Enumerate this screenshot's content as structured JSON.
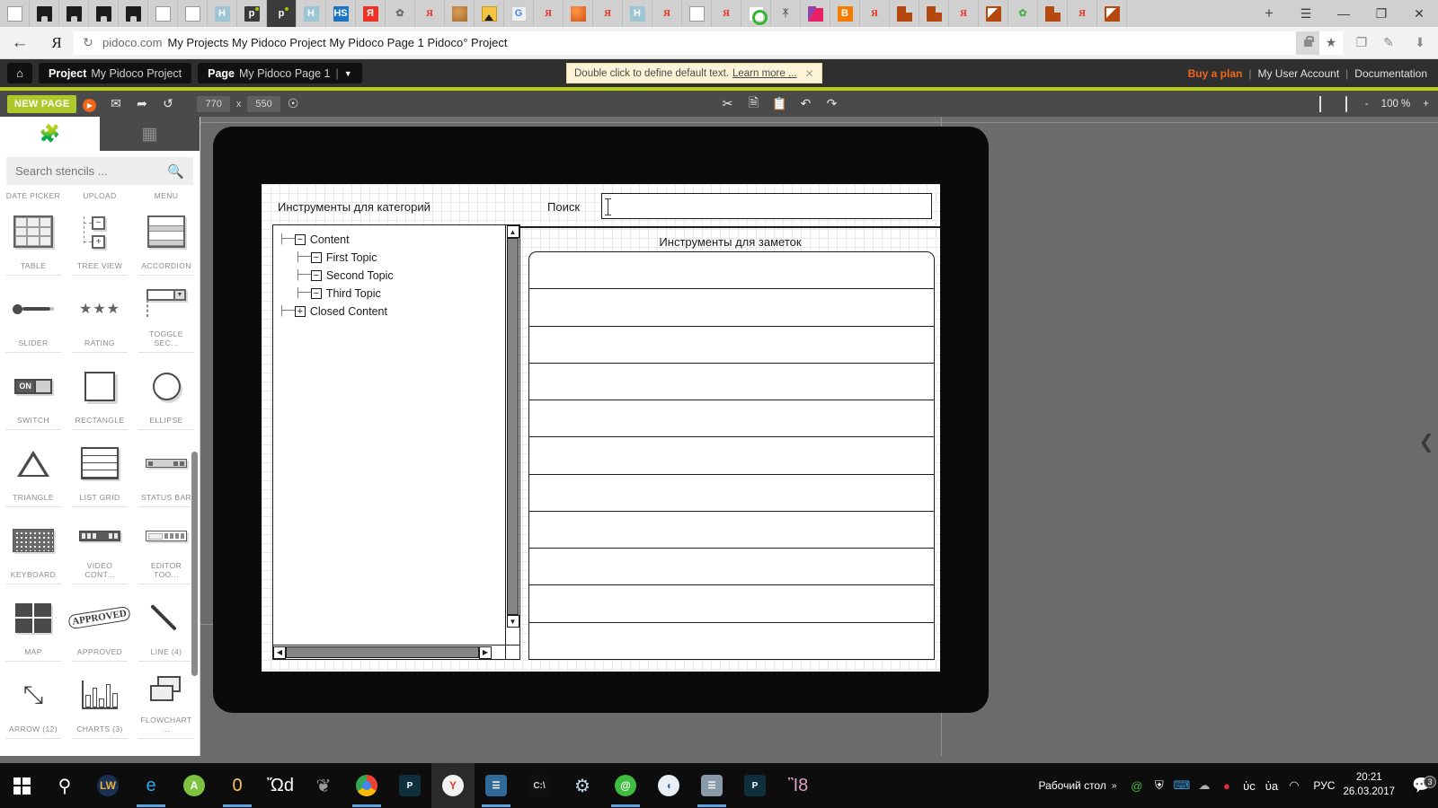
{
  "browser": {
    "tabs": [
      {
        "name": "tab-doc-1",
        "icon": "document-icon",
        "kind": "doc",
        "active": false
      },
      {
        "name": "tab-github-1",
        "icon": "github-icon",
        "kind": "gh",
        "active": false
      },
      {
        "name": "tab-github-2",
        "icon": "github-icon",
        "kind": "gh",
        "active": false
      },
      {
        "name": "tab-github-3",
        "icon": "github-icon",
        "kind": "gh",
        "active": false
      },
      {
        "name": "tab-github-4",
        "icon": "github-icon",
        "kind": "gh",
        "active": false
      },
      {
        "name": "tab-doc-2",
        "icon": "document-icon",
        "kind": "doc",
        "active": false
      },
      {
        "name": "tab-doc-3",
        "icon": "document-icon",
        "kind": "doc",
        "active": false
      },
      {
        "name": "tab-habr-1",
        "icon": "habr-icon",
        "kind": "h",
        "label": "H",
        "active": false
      },
      {
        "name": "tab-pidoco-1",
        "icon": "pidoco-icon",
        "kind": "p",
        "label": "р",
        "active": false
      },
      {
        "name": "tab-pidoco-2",
        "icon": "pidoco-icon",
        "kind": "p",
        "label": "р",
        "active": true
      },
      {
        "name": "tab-habr-2",
        "icon": "habr-icon",
        "kind": "h",
        "label": "H",
        "active": false
      },
      {
        "name": "tab-hs",
        "icon": "hs-icon",
        "kind": "hs",
        "label": "HS",
        "active": false
      },
      {
        "name": "tab-yandex-1",
        "icon": "yandex-icon",
        "kind": "ya",
        "label": "Я",
        "active": false
      },
      {
        "name": "tab-extension-1",
        "icon": "puzzle-icon",
        "kind": "puz",
        "label": "✿",
        "active": false
      },
      {
        "name": "tab-yandex-2",
        "icon": "yandex-red-icon",
        "kind": "yr",
        "label": "Я",
        "active": false
      },
      {
        "name": "tab-cookie",
        "icon": "cookie-icon",
        "kind": "cookie",
        "active": false
      },
      {
        "name": "tab-image",
        "icon": "image-icon",
        "kind": "img",
        "active": false
      },
      {
        "name": "tab-translate",
        "icon": "google-translate-icon",
        "kind": "gt",
        "label": "G",
        "active": false
      },
      {
        "name": "tab-yandex-3",
        "icon": "yandex-red-icon",
        "kind": "yr",
        "label": "Я",
        "active": false
      },
      {
        "name": "tab-globe",
        "icon": "globe-icon",
        "kind": "globe",
        "active": false
      },
      {
        "name": "tab-yandex-4",
        "icon": "yandex-red-icon",
        "kind": "yr",
        "label": "Я",
        "active": false
      },
      {
        "name": "tab-habr-3",
        "icon": "habr-icon",
        "kind": "h",
        "label": "H",
        "active": false
      },
      {
        "name": "tab-yandex-5",
        "icon": "yandex-red-icon",
        "kind": "yr",
        "label": "Я",
        "active": false
      },
      {
        "name": "tab-doc-4",
        "icon": "document-icon",
        "kind": "doc",
        "active": false
      },
      {
        "name": "tab-yandex-6",
        "icon": "yandex-red-icon",
        "kind": "yr",
        "label": "Я",
        "active": false
      },
      {
        "name": "tab-target",
        "icon": "target-icon",
        "kind": "target",
        "active": false
      },
      {
        "name": "tab-gnu",
        "icon": "gnu-icon",
        "kind": "gnu",
        "label": "ᛡ",
        "active": false
      },
      {
        "name": "tab-triangle",
        "icon": "prism-icon",
        "kind": "tri",
        "active": false
      },
      {
        "name": "tab-blogger",
        "icon": "blogger-icon",
        "kind": "b",
        "label": "B",
        "active": false
      },
      {
        "name": "tab-yandex-7",
        "icon": "yandex-red-icon",
        "kind": "yr",
        "label": "Я",
        "active": false
      },
      {
        "name": "tab-squares-1",
        "icon": "squares-icon",
        "kind": "sq",
        "active": false
      },
      {
        "name": "tab-squares-2",
        "icon": "squares-icon",
        "kind": "sq",
        "active": false
      },
      {
        "name": "tab-yandex-8",
        "icon": "yandex-red-icon",
        "kind": "yr",
        "label": "Я",
        "active": false
      },
      {
        "name": "tab-k-1",
        "icon": "kompas-icon",
        "kind": "k",
        "active": false
      },
      {
        "name": "tab-extension-2",
        "icon": "puzzle-green-icon",
        "kind": "puzg",
        "label": "✿",
        "active": false
      },
      {
        "name": "tab-squares-3",
        "icon": "squares-icon",
        "kind": "sq",
        "active": false
      },
      {
        "name": "tab-yandex-9",
        "icon": "yandex-red-icon",
        "kind": "yr",
        "label": "Я",
        "active": false
      },
      {
        "name": "tab-k-2",
        "icon": "kompas-icon",
        "kind": "k",
        "active": false
      }
    ],
    "new_tab_label": "+",
    "window_controls": {
      "menu": "☰",
      "minimize": "—",
      "maximize": "❐",
      "close": "✕"
    },
    "address_bar": {
      "back_label": "←",
      "yandex_logo": "Я",
      "reload_label": "↻",
      "domain": "pidoco.com",
      "page_title": "My Projects My Pidoco Project My Pidoco Page 1 Pidoco° Project",
      "star_label": "★",
      "reader_label": "❐",
      "notes_label": "✎",
      "download_label": "⬇"
    }
  },
  "app_header": {
    "home_label": "⌂",
    "project_crumb": {
      "key": "Project",
      "value": "My Pidoco Project"
    },
    "page_crumb": {
      "key": "Page",
      "value": "My Pidoco Page 1",
      "separator": "|",
      "caret": "▼"
    },
    "hint": {
      "text": "Double click to define default text.",
      "link": "Learn more ...",
      "close": "✕"
    },
    "links": {
      "buy": "Buy a plan",
      "sep1": "|",
      "account": "My User Account",
      "sep2": "|",
      "docs": "Documentation"
    }
  },
  "app_toolbar": {
    "new_page": "NEW PAGE",
    "play_icon": "play-icon",
    "mail_icon": "mail-icon",
    "share_icon": "share-icon",
    "refresh_icon": "refresh-icon",
    "width": "770",
    "x_label": "x",
    "height": "550",
    "more_icon": "more-options-icon",
    "cut_icon": "✂",
    "copy_icon": "☰",
    "paste_icon": "☰",
    "undo_icon": "↶",
    "redo_icon": "↷",
    "grid_icon": "grid-icon",
    "device_icon": "device-icon",
    "zoom_out": "-",
    "zoom_value": "100 %",
    "zoom_in": "+"
  },
  "stencils": {
    "tab_shapes_icon": "puzzle-icon",
    "tab_pages_icon": "puzzle-pieces-icon",
    "search_placeholder": "Search stencils ...",
    "search_value": "",
    "search_icon": "magnifier-icon",
    "cut_row_labels": [
      "DATE PICKER",
      "UPLOAD",
      "MENU"
    ],
    "items": [
      {
        "label": "TABLE",
        "art": "table"
      },
      {
        "label": "TREE VIEW",
        "art": "tree"
      },
      {
        "label": "ACCORDION",
        "art": "accordion"
      },
      {
        "label": "SLIDER",
        "art": "slider"
      },
      {
        "label": "RATING",
        "art": "rating"
      },
      {
        "label": "TOGGLE SEC...",
        "art": "toggle"
      },
      {
        "label": "SWITCH",
        "art": "switch"
      },
      {
        "label": "RECTANGLE",
        "art": "rect"
      },
      {
        "label": "ELLIPSE",
        "art": "ellipse"
      },
      {
        "label": "TRIANGLE",
        "art": "triangle"
      },
      {
        "label": "LIST GRID",
        "art": "listgrid"
      },
      {
        "label": "STATUS BAR",
        "art": "statusbar"
      },
      {
        "label": "KEYBOARD",
        "art": "keyboard"
      },
      {
        "label": "VIDEO CONT...",
        "art": "videoctl"
      },
      {
        "label": "EDITOR TOO...",
        "art": "editortb"
      },
      {
        "label": "MAP",
        "art": "map"
      },
      {
        "label": "APPROVED",
        "art": "approved"
      },
      {
        "label": "LINE (4)",
        "art": "line"
      },
      {
        "label": "ARROW (12)",
        "art": "arrow"
      },
      {
        "label": "CHARTS (3)",
        "art": "charts"
      },
      {
        "label": "FLOWCHART ...",
        "art": "flow"
      }
    ],
    "switch_on_label": "ON",
    "rating_stars": "★★★",
    "approved_label": "APPROVED",
    "arrow_glyph": "⤡"
  },
  "wireframe": {
    "title_categories": "Инструменты для категорий",
    "search_label": "Поиск",
    "search_value": "",
    "title_notes": "Инструменты для заметок",
    "tree": [
      {
        "label": "Content",
        "toggle": "−",
        "depth": 0
      },
      {
        "label": "First Topic",
        "toggle": "−",
        "depth": 1
      },
      {
        "label": "Second Topic",
        "toggle": "−",
        "depth": 1
      },
      {
        "label": "Third Topic",
        "toggle": "−",
        "depth": 1
      },
      {
        "label": "Closed Content",
        "toggle": "+",
        "depth": 0
      }
    ],
    "scroll": {
      "up": "▲",
      "down": "▼",
      "left": "◀",
      "right": "▶"
    },
    "list_rows": 11,
    "collapse_handle": "❮"
  },
  "taskbar": {
    "items": [
      {
        "name": "start-button",
        "icon": "windows-logo-icon",
        "kind": "win"
      },
      {
        "name": "search-button",
        "icon": "magnifier-icon",
        "kind": "glyph",
        "glyph": "⚲",
        "color": "#ffffff"
      },
      {
        "name": "taskview-lw",
        "icon": "lw-icon",
        "kind": "circle",
        "label": "LW",
        "bg": "#1a2f55",
        "fg": "#e8b53c"
      },
      {
        "name": "edge-button",
        "icon": "edge-icon",
        "kind": "glyph",
        "glyph": "e",
        "color": "#2fa7e8",
        "running": true
      },
      {
        "name": "androidstudio-button",
        "icon": "android-studio-icon",
        "kind": "circle",
        "label": "A",
        "bg": "#7ec242",
        "fg": "#ffffff"
      },
      {
        "name": "explorer-button",
        "icon": "folder-icon",
        "kind": "glyph",
        "glyph": "὜0",
        "color": "#f3c760",
        "running": true
      },
      {
        "name": "store-button",
        "icon": "store-icon",
        "kind": "glyph",
        "glyph": "Ὤd",
        "color": "#ffffff"
      },
      {
        "name": "gimp-button",
        "icon": "gimp-icon",
        "kind": "glyph",
        "glyph": "❦",
        "color": "#9a9a9a"
      },
      {
        "name": "chrome-button",
        "icon": "chrome-icon",
        "kind": "chrome",
        "running": true
      },
      {
        "name": "pw-button-1",
        "icon": "pw-icon",
        "kind": "sq",
        "label": "P",
        "bg": "#0f2f3f",
        "fg": "#ffffff"
      },
      {
        "name": "yandex-browser-button",
        "icon": "yandex-icon",
        "kind": "circle",
        "label": "Y",
        "bg": "#f2f2f2",
        "fg": "#e8392b",
        "hl": true
      },
      {
        "name": "notes-button",
        "icon": "notepad-icon",
        "kind": "sq",
        "label": "☰",
        "bg": "#2f6a9a",
        "fg": "#ffffff",
        "running": true
      },
      {
        "name": "console-button",
        "icon": "console-icon",
        "kind": "sq",
        "label": "C:\\",
        "bg": "#101010",
        "fg": "#d8d8d8"
      },
      {
        "name": "settings-button",
        "icon": "gear-icon",
        "kind": "glyph",
        "glyph": "⚙",
        "color": "#b9d8ee"
      },
      {
        "name": "qip-button",
        "icon": "at-icon",
        "kind": "circle",
        "label": "@",
        "bg": "#3fbb3f",
        "fg": "#ffffff",
        "running": true
      },
      {
        "name": "torrent-button",
        "icon": "wave-icon",
        "kind": "circle",
        "label": "◖",
        "bg": "#e9eef2",
        "fg": "#1e6fa8"
      },
      {
        "name": "monitor-button",
        "icon": "monitor-icon",
        "kind": "sq",
        "label": "☰",
        "bg": "#8a9aa8",
        "fg": "#ffffff",
        "running": true
      },
      {
        "name": "pw-button-2",
        "icon": "pw-icon",
        "kind": "sq",
        "label": "P",
        "bg": "#0f2f3f",
        "fg": "#ffffff"
      },
      {
        "name": "paint-button",
        "icon": "palette-icon",
        "kind": "glyph",
        "glyph": "Ἲ8",
        "color": "#e0a0c0"
      }
    ],
    "tray": {
      "desktop_label": "Рабочий стол",
      "overflow": "»",
      "icons": [
        {
          "name": "tray-qip-icon",
          "glyph": "@",
          "color": "#3fbb3f"
        },
        {
          "name": "tray-defender-icon",
          "glyph": "⛨",
          "color": "#ffffff"
        },
        {
          "name": "tray-keyboard-icon",
          "glyph": "⌨",
          "color": "#3aa0e0"
        },
        {
          "name": "tray-onedrive-icon",
          "glyph": "☁",
          "color": "#b0b0b0"
        },
        {
          "name": "tray-opera-icon",
          "glyph": "●",
          "color": "#e02b3c"
        },
        {
          "name": "tray-battery-icon",
          "glyph": "ὐc",
          "color": "#ffffff"
        },
        {
          "name": "tray-volume-icon",
          "glyph": "ὐa",
          "color": "#ffffff"
        },
        {
          "name": "tray-network-icon",
          "glyph": "◠",
          "color": "#d8d8d8"
        }
      ],
      "language": "РУС",
      "time": "20:21",
      "date": "26.03.2017",
      "notification_icon": "notification-icon",
      "notification_count": "3"
    }
  },
  "colors": {
    "accent_green": "#b5cc18",
    "brand_orange": "#f0651a",
    "header_dark": "#2f2f2f",
    "toolbar_dark": "#4a4a4a",
    "canvas_gray": "#6b6b6b"
  }
}
